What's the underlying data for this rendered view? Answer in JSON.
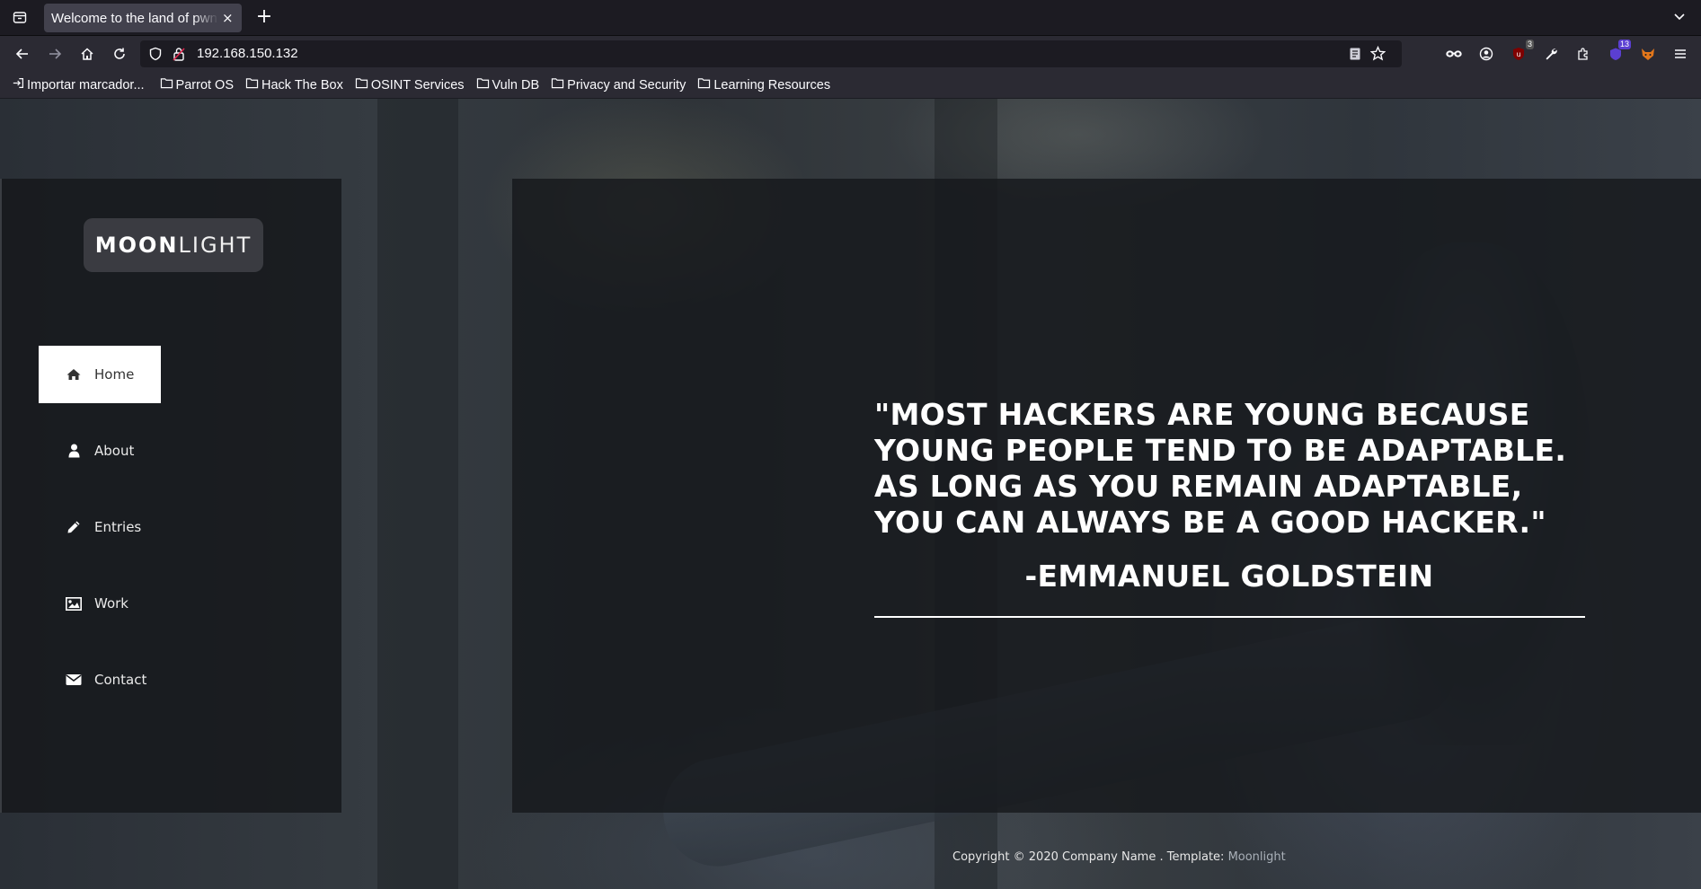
{
  "browser": {
    "tab_title": "Welcome to the land of pwn",
    "tab_close": "×",
    "new_tab": "+",
    "url": "192.168.150.132",
    "extensions": [
      {
        "name": "ublock-icon",
        "badge": "3",
        "badge_color": "#555555"
      },
      {
        "name": "container-icon",
        "badge": "13",
        "badge_color": "#5b3fd1"
      }
    ],
    "bookmarks": [
      {
        "label": "Importar marcador...",
        "icon": "import-icon"
      },
      {
        "label": "Parrot OS",
        "icon": "folder-icon"
      },
      {
        "label": "Hack The Box",
        "icon": "folder-icon"
      },
      {
        "label": "OSINT Services",
        "icon": "folder-icon"
      },
      {
        "label": "Vuln DB",
        "icon": "folder-icon"
      },
      {
        "label": "Privacy and Security",
        "icon": "folder-icon"
      },
      {
        "label": "Learning Resources",
        "icon": "folder-icon"
      }
    ]
  },
  "site": {
    "logo_bold": "MOON",
    "logo_light": "LIGHT",
    "menu": [
      {
        "label": "Home",
        "icon": "home-icon",
        "active": true
      },
      {
        "label": "About",
        "icon": "user-icon",
        "active": false
      },
      {
        "label": "Entries",
        "icon": "pencil-icon",
        "active": false
      },
      {
        "label": "Work",
        "icon": "image-icon",
        "active": false
      },
      {
        "label": "Contact",
        "icon": "envelope-icon",
        "active": false
      }
    ],
    "quote": "\"MOST HACKERS ARE YOUNG BECAUSE YOUNG PEOPLE TEND TO BE ADAPTABLE. AS LONG AS YOU REMAIN ADAPTABLE, YOU CAN ALWAYS BE A GOOD HACKER.\"",
    "attribution": "-EMMANUEL GOLDSTEIN",
    "footer": {
      "copyright": "Copyright © 2020 Company Name . Template: ",
      "template_link": "Moonlight"
    }
  },
  "colors": {
    "menu_active_bg": "#ffffff",
    "panel_bg": "#16181c",
    "accent_link": "#a9b0b8"
  }
}
